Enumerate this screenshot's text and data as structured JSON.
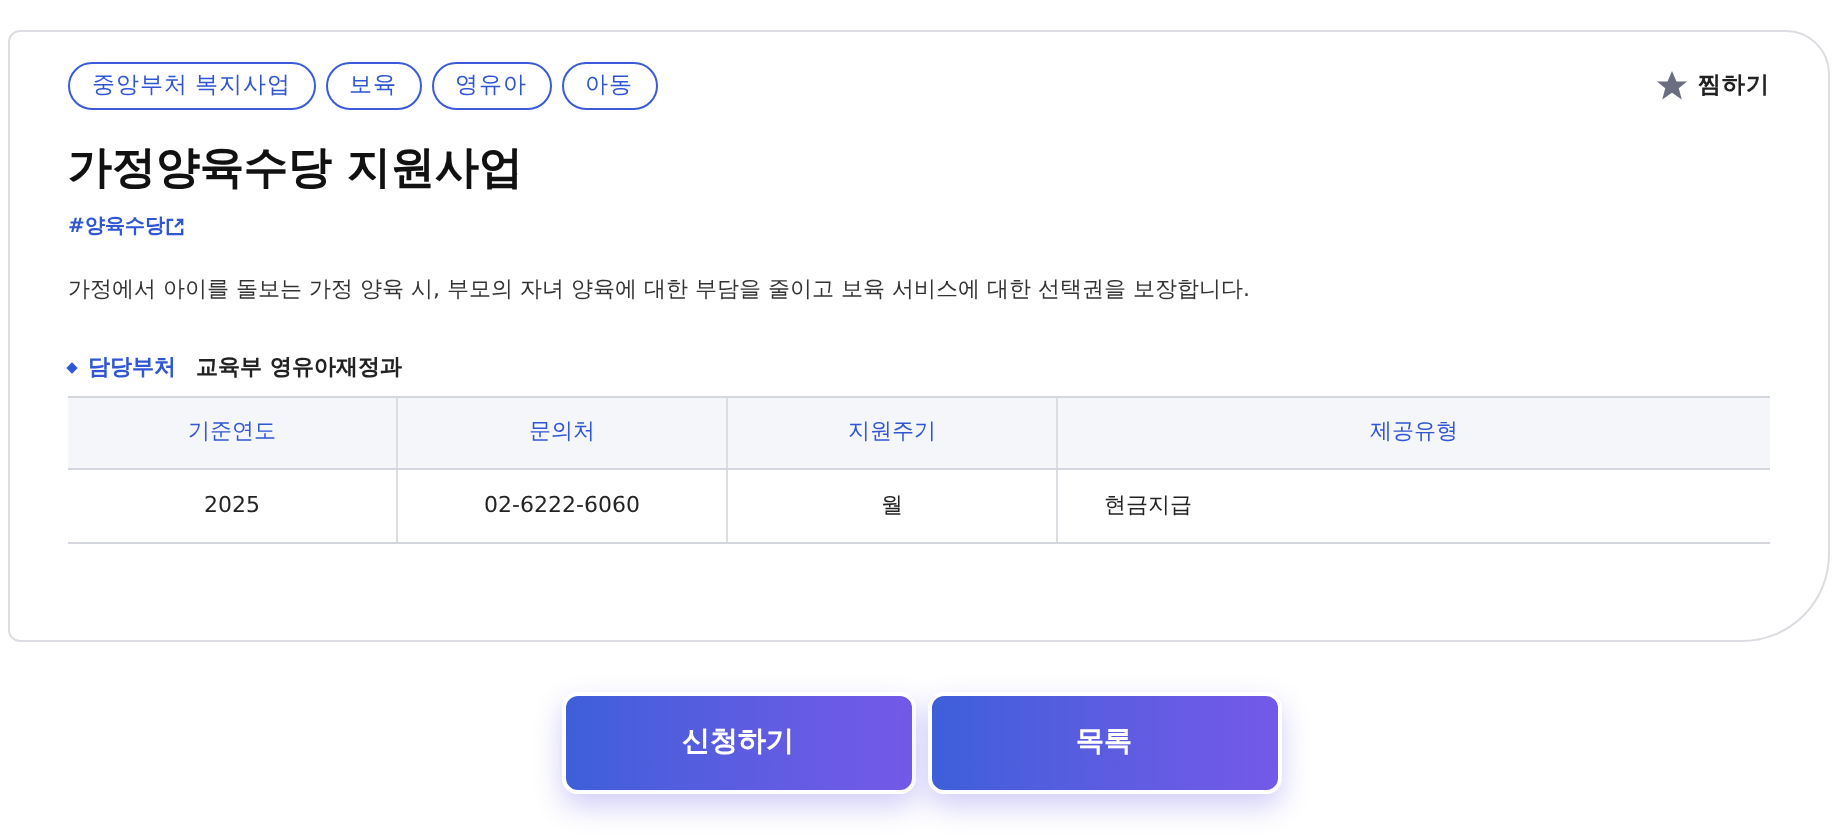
{
  "tags": [
    "중앙부처 복지사업",
    "보육",
    "영유아",
    "아동"
  ],
  "bookmark": {
    "label": "찜하기",
    "selected": false
  },
  "title": "가정양육수당 지원사업",
  "hashtag": "#양육수당",
  "description": "가정에서 아이를 돌보는 가정 양육 시, 부모의 자녀 양육에 대한 부담을 줄이고 보육 서비스에 대한 선택권을 보장합니다.",
  "department": {
    "label": "담당부처",
    "value": "교육부 영유아재정과"
  },
  "table": {
    "columns": [
      "기준연도",
      "문의처",
      "지원주기",
      "제공유형"
    ],
    "rows": [
      [
        "2025",
        "02-6222-6060",
        "월",
        "현금지급"
      ]
    ]
  },
  "buttons": [
    "신청하기",
    "목록"
  ]
}
